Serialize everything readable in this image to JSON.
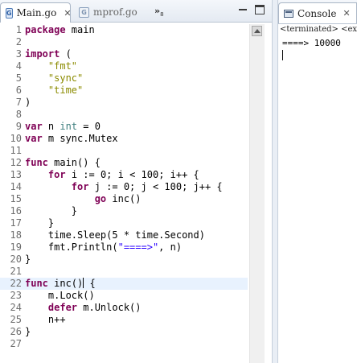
{
  "editor": {
    "tabs": [
      {
        "label": "Main.go",
        "icon": "go-file-icon"
      },
      {
        "label": "mprof.go",
        "icon": "go-file-icon"
      }
    ],
    "overflow_label": "»",
    "overflow_count": "8",
    "lines": [
      {
        "n": "1",
        "html": "<span class='kw'>package</span> main"
      },
      {
        "n": "2",
        "html": ""
      },
      {
        "n": "3",
        "html": "<span class='kw'>import</span> ("
      },
      {
        "n": "4",
        "html": "    <span class='st'>\"fmt\"</span>"
      },
      {
        "n": "5",
        "html": "    <span class='st'>\"sync\"</span>"
      },
      {
        "n": "6",
        "html": "    <span class='st'>\"time\"</span>"
      },
      {
        "n": "7",
        "html": ")"
      },
      {
        "n": "8",
        "html": ""
      },
      {
        "n": "9",
        "html": "<span class='kw'>var</span> n <span class='ty'>int</span> = 0"
      },
      {
        "n": "10",
        "html": "<span class='kw'>var</span> m sync.Mutex"
      },
      {
        "n": "11",
        "html": ""
      },
      {
        "n": "12",
        "html": "<span class='kw'>func</span> main() {"
      },
      {
        "n": "13",
        "html": "    <span class='kw'>for</span> i := 0; i &lt; 100; i++ {"
      },
      {
        "n": "14",
        "html": "        <span class='kw'>for</span> j := 0; j &lt; 100; j++ {"
      },
      {
        "n": "15",
        "html": "            <span class='kw'>go</span> inc()"
      },
      {
        "n": "16",
        "html": "        }"
      },
      {
        "n": "17",
        "html": "    }"
      },
      {
        "n": "18",
        "html": "    time.Sleep(5 * time.Second)"
      },
      {
        "n": "19",
        "html": "    fmt.Println(<span class='st2'>\"====>\"</span>, n)"
      },
      {
        "n": "20",
        "html": "}"
      },
      {
        "n": "21",
        "html": ""
      },
      {
        "n": "22",
        "html": "<span class='kw'>func</span> inc()<span class='cursor'></span> {",
        "current": true
      },
      {
        "n": "23",
        "html": "    m.Lock()"
      },
      {
        "n": "24",
        "html": "    <span class='kw'>defer</span> m.Unlock()"
      },
      {
        "n": "25",
        "html": "    n++"
      },
      {
        "n": "26",
        "html": "}"
      },
      {
        "n": "27",
        "html": ""
      }
    ]
  },
  "console": {
    "tab_label": "Console",
    "status": "<terminated> <exit c",
    "output": "====> 10000"
  },
  "colors": {
    "keyword": "#7f0055",
    "type": "#3f7f7f",
    "string": "#8b8b00",
    "current_line": "#e8f2fe"
  }
}
